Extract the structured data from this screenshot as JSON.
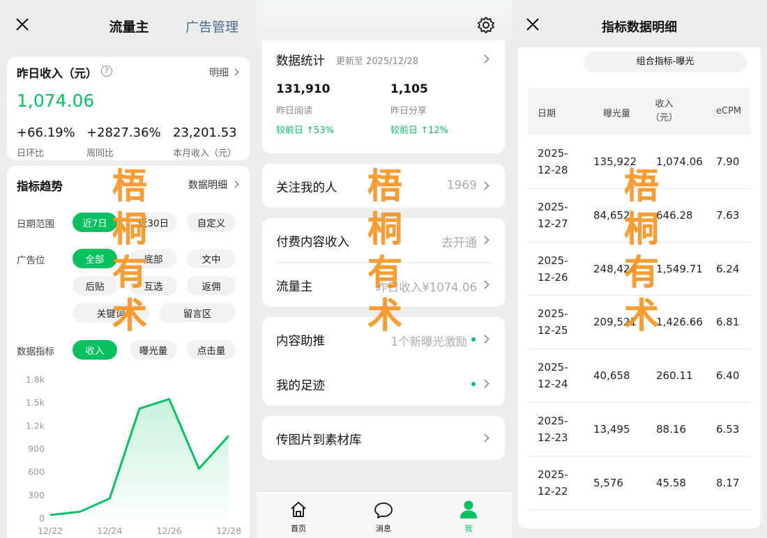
{
  "p1": {
    "nav": {
      "title": "流量主",
      "right": "广告管理"
    },
    "income": {
      "title": "昨日收入（元）",
      "detail": "明细",
      "value": "1,074.06",
      "stats": [
        {
          "value": "+66.19%",
          "label": "日环比"
        },
        {
          "value": "+2827.36%",
          "label": "周同比"
        },
        {
          "value": "23,201.53",
          "label": "本月收入（元）"
        }
      ]
    },
    "trend": {
      "title": "指标趋势",
      "detail": "数据明细",
      "date_label": "日期范围",
      "date_options": [
        "近7日",
        "近30日",
        "自定义"
      ],
      "adpos_label": "广告位",
      "adpos_options": [
        "全部",
        "底部",
        "文中",
        "后贴",
        "互选",
        "返佣",
        "关键词",
        "留言区"
      ],
      "metric_label": "数据指标",
      "metric_options": [
        "收入",
        "曝光量",
        "点击量"
      ]
    },
    "chart_data": {
      "type": "area",
      "x": [
        "12/22",
        "12/23",
        "12/24",
        "12/25",
        "12/26",
        "12/27",
        "12/28"
      ],
      "y_ticks": [
        "1.8k",
        "1.5k",
        "1.2k",
        "900",
        "600",
        "300",
        "0"
      ],
      "x_tick_labels": [
        "12/22",
        "12/24",
        "12/26",
        "12/28"
      ],
      "series": [
        {
          "values": [
            45.58,
            88.16,
            260.11,
            1426.66,
            1549.71,
            646.28,
            1074.06
          ]
        }
      ],
      "ylim": [
        0,
        1800
      ],
      "grid": false,
      "color": "#07c160"
    },
    "watermark": [
      "梧",
      "桐",
      "有",
      "术"
    ]
  },
  "p2": {
    "stats_card": {
      "title": "数据统计",
      "updated": "更新至 2025/12/28",
      "items": [
        {
          "value": "131,910",
          "label": "昨日阅读",
          "compare": "较前日 ↑53%"
        },
        {
          "value": "1,105",
          "label": "昨日分享",
          "compare": "较前日 ↑12%"
        }
      ]
    },
    "followers": {
      "label": "关注我的人",
      "value": "1969"
    },
    "paid": {
      "label": "付费内容收入",
      "value": "去开通"
    },
    "flow": {
      "label": "流量主",
      "value": "昨日收入¥1074.06"
    },
    "promo": {
      "label": "内容助推",
      "value": "1个新曝光激励"
    },
    "footprint": {
      "label": "我的足迹"
    },
    "upload": {
      "label": "传图片到素材库"
    },
    "tabbar": [
      {
        "label": "首页",
        "icon": "home-icon"
      },
      {
        "label": "消息",
        "icon": "message-icon"
      },
      {
        "label": "我",
        "icon": "user-icon"
      }
    ],
    "watermark": [
      "梧",
      "桐",
      "有",
      "术"
    ]
  },
  "p3": {
    "nav": {
      "title": "指标数据明细"
    },
    "filter": "组合指标-曝光",
    "table": {
      "headers": [
        "日期",
        "曝光量",
        "收入\n（元）",
        "eCPM"
      ],
      "rows": [
        [
          "2025-\n12-28",
          "135,922",
          "1,074.06",
          "7.90"
        ],
        [
          "2025-\n12-27",
          "84,652",
          "646.28",
          "7.63"
        ],
        [
          "2025-\n12-26",
          "248,424",
          "1,549.71",
          "6.24"
        ],
        [
          "2025-\n12-25",
          "209,521",
          "1,426.66",
          "6.81"
        ],
        [
          "2025-\n12-24",
          "40,658",
          "260.11",
          "6.40"
        ],
        [
          "2025-\n12-23",
          "13,495",
          "88.16",
          "6.53"
        ],
        [
          "2025-\n12-22",
          "5,576",
          "45.58",
          "8.17"
        ]
      ]
    },
    "watermark": [
      "梧",
      "桐",
      "有",
      "术"
    ]
  },
  "colors": {
    "accent": "#07c160",
    "watermark": "#f7931e",
    "background": "#ededed"
  }
}
